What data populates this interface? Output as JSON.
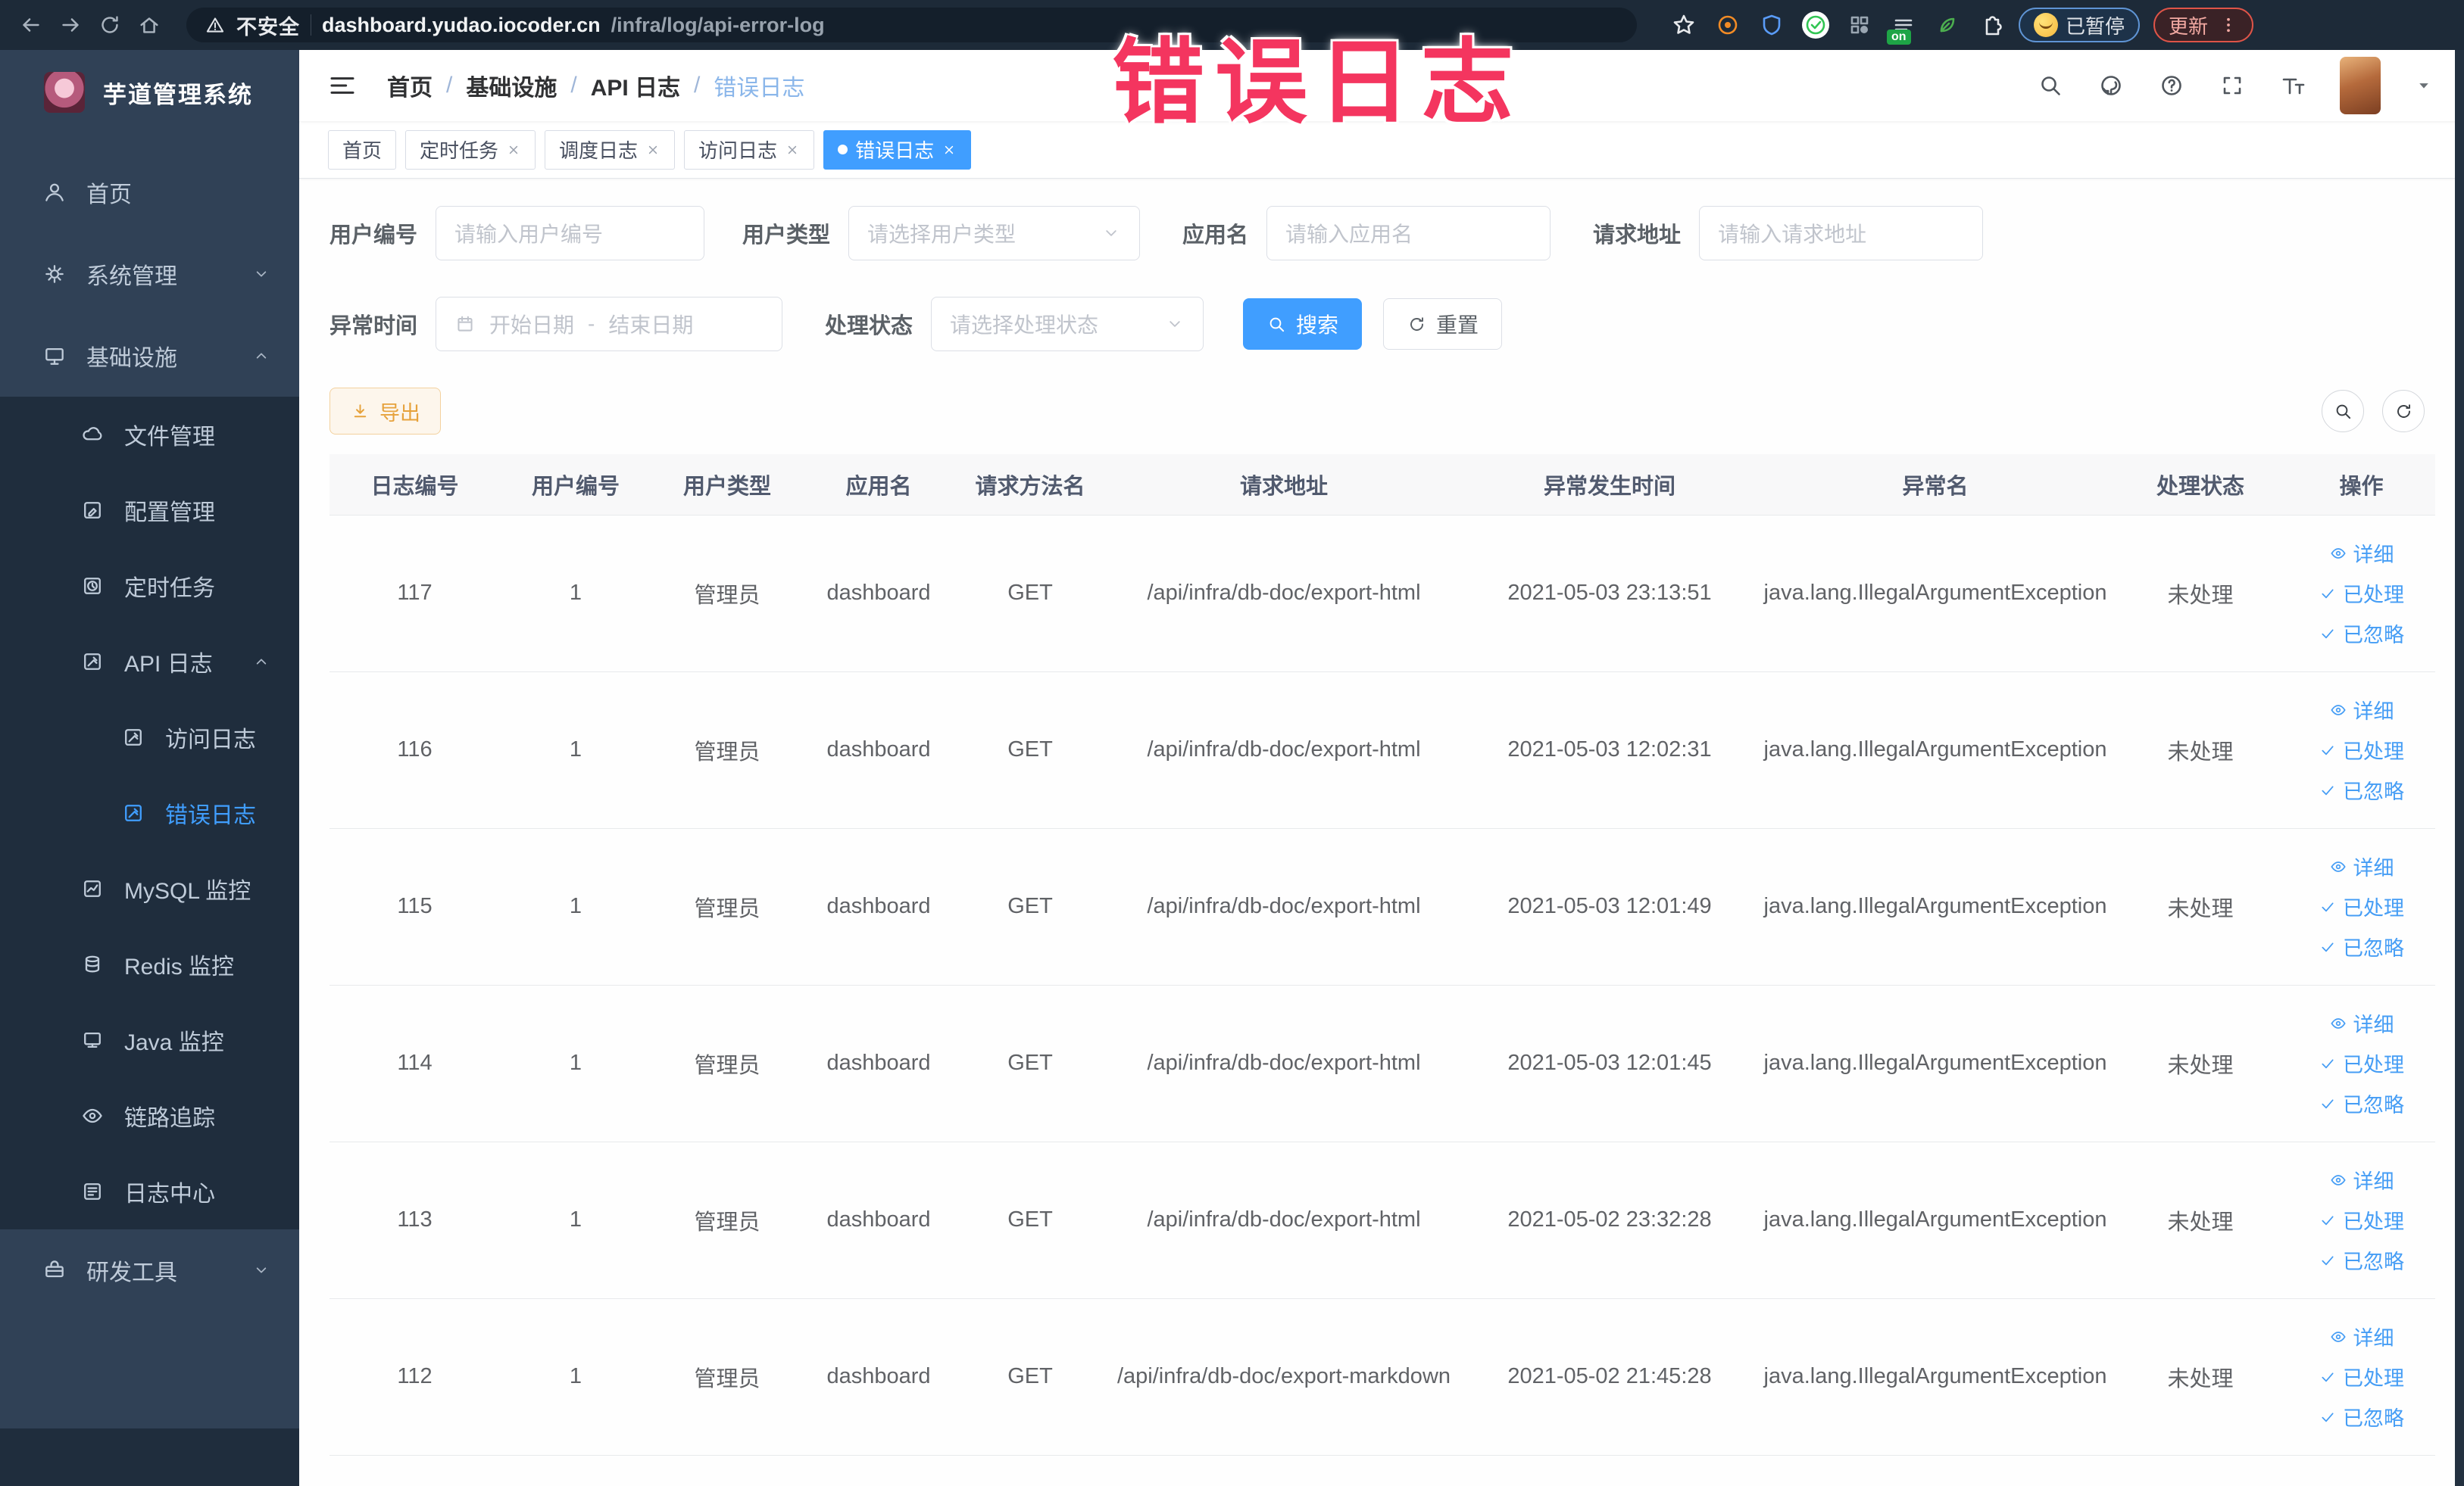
{
  "browser": {
    "security_label": "不安全",
    "url_host": "dashboard.yudao.iocoder.cn",
    "url_path": "/infra/log/api-error-log",
    "on_badge": "on",
    "paused_pill": "已暂停",
    "update_pill": "更新",
    "nav_icons": [
      "back-icon",
      "forward-icon",
      "reload-icon",
      "browser-home-icon"
    ],
    "extension_icons": [
      "bookmark-star-icon",
      "target-extension-icon",
      "shield-extension-icon",
      "check-extension-icon",
      "grid-extension-icon",
      "adblock-extension-icon",
      "leaf-extension-icon",
      "puzzle-extensions-icon"
    ]
  },
  "overlay": {
    "text": "错误日志",
    "color": "#f4355f"
  },
  "sidebar": {
    "logo_title": "芋道管理系统",
    "items": [
      {
        "label": "首页",
        "icon": "home-menu-icon",
        "level": 0
      },
      {
        "label": "系统管理",
        "icon": "gear-icon",
        "level": 0,
        "arrow": "down"
      },
      {
        "label": "基础设施",
        "icon": "monitor-icon",
        "level": 0,
        "arrow": "up"
      },
      {
        "label": "文件管理",
        "icon": "cloud-icon",
        "level": 1
      },
      {
        "label": "配置管理",
        "icon": "edit-icon",
        "level": 1
      },
      {
        "label": "定时任务",
        "icon": "clock-icon",
        "level": 1
      },
      {
        "label": "API 日志",
        "icon": "log-icon",
        "level": 1,
        "arrow": "up"
      },
      {
        "label": "访问日志",
        "icon": "access-log-icon",
        "level": 2
      },
      {
        "label": "错误日志",
        "icon": "error-log-icon",
        "level": 2,
        "active": true
      },
      {
        "label": "MySQL 监控",
        "icon": "chart-icon",
        "level": 1
      },
      {
        "label": "Redis 监控",
        "icon": "database-icon",
        "level": 1
      },
      {
        "label": "Java 监控",
        "icon": "java-monitor-icon",
        "level": 1
      },
      {
        "label": "链路追踪",
        "icon": "trace-eye-icon",
        "level": 1
      },
      {
        "label": "日志中心",
        "icon": "log-center-icon",
        "level": 1
      },
      {
        "label": "研发工具",
        "icon": "toolbox-icon",
        "level": 0,
        "arrow": "down"
      }
    ]
  },
  "navbar": {
    "breadcrumb": [
      "首页",
      "基础设施",
      "API 日志",
      "错误日志"
    ],
    "right_icons": [
      "search-icon",
      "github-icon",
      "help-icon",
      "fullscreen-icon",
      "font-size-icon"
    ]
  },
  "tags": [
    {
      "label": "首页",
      "closable": false,
      "active": false
    },
    {
      "label": "定时任务",
      "closable": true,
      "active": false
    },
    {
      "label": "调度日志",
      "closable": true,
      "active": false
    },
    {
      "label": "访问日志",
      "closable": true,
      "active": false
    },
    {
      "label": "错误日志",
      "closable": true,
      "active": true
    }
  ],
  "filters": {
    "user_id": {
      "label": "用户编号",
      "placeholder": "请输入用户编号"
    },
    "user_type": {
      "label": "用户类型",
      "placeholder": "请选择用户类型"
    },
    "app_name": {
      "label": "应用名",
      "placeholder": "请输入应用名"
    },
    "request_url": {
      "label": "请求地址",
      "placeholder": "请输入请求地址"
    },
    "exception_time": {
      "label": "异常时间",
      "start_placeholder": "开始日期",
      "separator": "-",
      "end_placeholder": "结束日期"
    },
    "process_status": {
      "label": "处理状态",
      "placeholder": "请选择处理状态"
    },
    "search_button": "搜索",
    "reset_button": "重置"
  },
  "toolbar": {
    "export_label": "导出"
  },
  "table": {
    "columns": [
      "日志编号",
      "用户编号",
      "用户类型",
      "应用名",
      "请求方法名",
      "请求地址",
      "异常发生时间",
      "异常名",
      "处理状态",
      "操作"
    ],
    "action_labels": [
      "详细",
      "已处理",
      "已忽略"
    ],
    "rows": [
      {
        "id": "117",
        "user_id": "1",
        "user_type": "管理员",
        "app": "dashboard",
        "method": "GET",
        "url": "/api/infra/db-doc/export-html",
        "time": "2021-05-03 23:13:51",
        "exception": "java.lang.IllegalArgumentException",
        "status": "未处理"
      },
      {
        "id": "116",
        "user_id": "1",
        "user_type": "管理员",
        "app": "dashboard",
        "method": "GET",
        "url": "/api/infra/db-doc/export-html",
        "time": "2021-05-03 12:02:31",
        "exception": "java.lang.IllegalArgumentException",
        "status": "未处理"
      },
      {
        "id": "115",
        "user_id": "1",
        "user_type": "管理员",
        "app": "dashboard",
        "method": "GET",
        "url": "/api/infra/db-doc/export-html",
        "time": "2021-05-03 12:01:49",
        "exception": "java.lang.IllegalArgumentException",
        "status": "未处理"
      },
      {
        "id": "114",
        "user_id": "1",
        "user_type": "管理员",
        "app": "dashboard",
        "method": "GET",
        "url": "/api/infra/db-doc/export-html",
        "time": "2021-05-03 12:01:45",
        "exception": "java.lang.IllegalArgumentException",
        "status": "未处理"
      },
      {
        "id": "113",
        "user_id": "1",
        "user_type": "管理员",
        "app": "dashboard",
        "method": "GET",
        "url": "/api/infra/db-doc/export-html",
        "time": "2021-05-02 23:32:28",
        "exception": "java.lang.IllegalArgumentException",
        "status": "未处理"
      },
      {
        "id": "112",
        "user_id": "1",
        "user_type": "管理员",
        "app": "dashboard",
        "method": "GET",
        "url": "/api/infra/db-doc/export-markdown",
        "time": "2021-05-02 21:45:28",
        "exception": "java.lang.IllegalArgumentException",
        "status": "未处理"
      }
    ]
  }
}
